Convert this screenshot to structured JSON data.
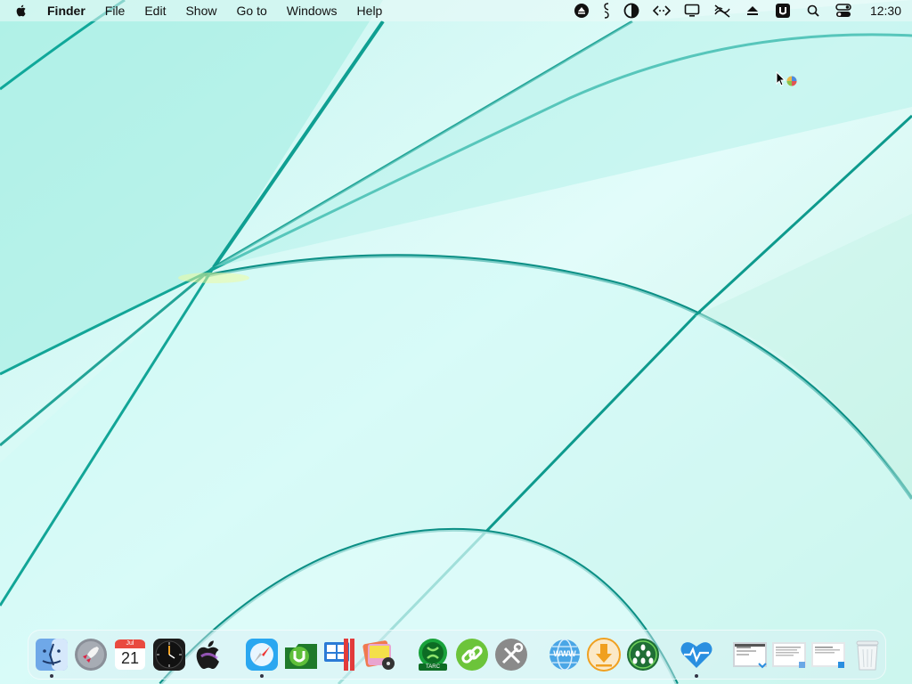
{
  "menubar": {
    "apple_icon": "apple-logo-icon",
    "app_name": "Finder",
    "menus": [
      "File",
      "Edit",
      "Show",
      "Go to",
      "Windows",
      "Help"
    ],
    "status_icons": [
      "eject-circle-icon",
      "script-icon",
      "contrast-icon",
      "code-icon",
      "display-icon",
      "mute-icon",
      "eject-icon",
      "u-badge-icon",
      "search-icon",
      "control-center-icon"
    ],
    "clock": "12:30"
  },
  "dock": {
    "items": [
      {
        "name": "finder",
        "icon": "finder-icon",
        "running": true
      },
      {
        "name": "launchpad",
        "icon": "rocket-icon",
        "running": false
      },
      {
        "name": "calendar",
        "icon": "calendar-icon",
        "month": "Jul",
        "day": "21",
        "running": false
      },
      {
        "name": "clock",
        "icon": "clock-icon",
        "running": false
      },
      {
        "name": "apple",
        "icon": "apple-icon",
        "running": false
      },
      {
        "name": "safari",
        "icon": "compass-icon",
        "running": true
      },
      {
        "name": "utorrent",
        "icon": "utorrent-icon",
        "running": false
      },
      {
        "name": "parallels",
        "icon": "parallels-windows-icon",
        "running": false
      },
      {
        "name": "photos",
        "icon": "photo-disc-icon",
        "running": false
      },
      {
        "name": "xtarchive",
        "icon": "archive-green-icon",
        "label": "TARC",
        "running": false
      },
      {
        "name": "link",
        "icon": "link-icon",
        "running": false
      },
      {
        "name": "utilities",
        "icon": "tools-icon",
        "running": false
      },
      {
        "name": "web",
        "icon": "www-globe-icon",
        "label": "WWW",
        "running": false
      },
      {
        "name": "downloader",
        "icon": "download-arrow-icon",
        "running": false
      },
      {
        "name": "cluster",
        "icon": "cluster-dots-icon",
        "running": false
      },
      {
        "name": "heart-monitor",
        "icon": "heart-pulse-icon",
        "running": true
      },
      {
        "name": "doc-1",
        "icon": "document-thumbnail-icon",
        "running": false
      },
      {
        "name": "doc-2",
        "icon": "document-thumbnail-icon",
        "running": false
      },
      {
        "name": "doc-3",
        "icon": "document-thumbnail-icon",
        "running": false
      },
      {
        "name": "trash",
        "icon": "trash-icon",
        "running": false
      }
    ]
  },
  "colors": {
    "wallpaper_base": "#bff3ee",
    "wallpaper_stroke": "#10a89a",
    "wallpaper_deep": "#0b8f85"
  }
}
